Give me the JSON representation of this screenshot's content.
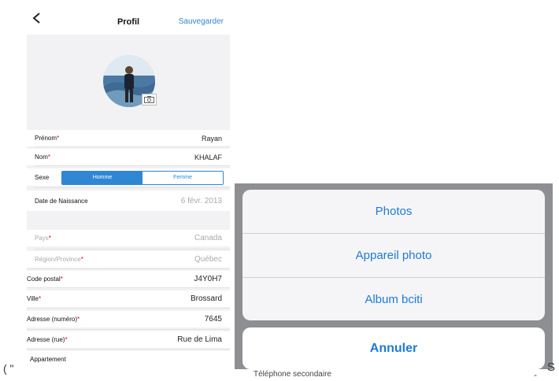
{
  "left_screen": {
    "nav": {
      "title": "Profil",
      "save_label": "Sauvegarder"
    },
    "fields": {
      "prenom": {
        "label": "Prénom",
        "required_mark": "*",
        "value": "Rayan"
      },
      "nom": {
        "label": "Nom",
        "required_mark": "*",
        "value": "KHALAF"
      },
      "sexe": {
        "label": "Sexe",
        "option_selected": "Homme",
        "option_other": "Femme"
      },
      "naissance": {
        "label": "Date de Naissance",
        "value": "6 févr. 2013"
      },
      "pays": {
        "label": "Pays",
        "required_mark": "*",
        "value": "Canada"
      },
      "region": {
        "label": "Région/Province",
        "required_mark": "*",
        "value": "Québec"
      },
      "code_postal": {
        "label": "Code postal",
        "required_mark": "*",
        "value": "J4Y0H7"
      },
      "ville": {
        "label": "Ville",
        "required_mark": "*",
        "value": "Brossard"
      },
      "adresse_numero": {
        "label": "Adresse (numéro)",
        "required_mark": "*",
        "value": "7645"
      },
      "adresse_rue": {
        "label": "Adresse (rue)",
        "required_mark": "*",
        "value": "Rue de Lima"
      },
      "appartement": {
        "label": "Appartement"
      }
    }
  },
  "right_screen": {
    "options": [
      "Photos",
      "Appareil photo",
      "Album bciti"
    ],
    "cancel_label": "Annuler",
    "behind_text": "Téléphone secondaire",
    "behind_dash": "-"
  },
  "captions": {
    "left": "( \"",
    "right": "S"
  },
  "colors": {
    "accent": "#2f86d3",
    "required": "#d0021b",
    "sheet_blue": "#1d7bd6"
  }
}
